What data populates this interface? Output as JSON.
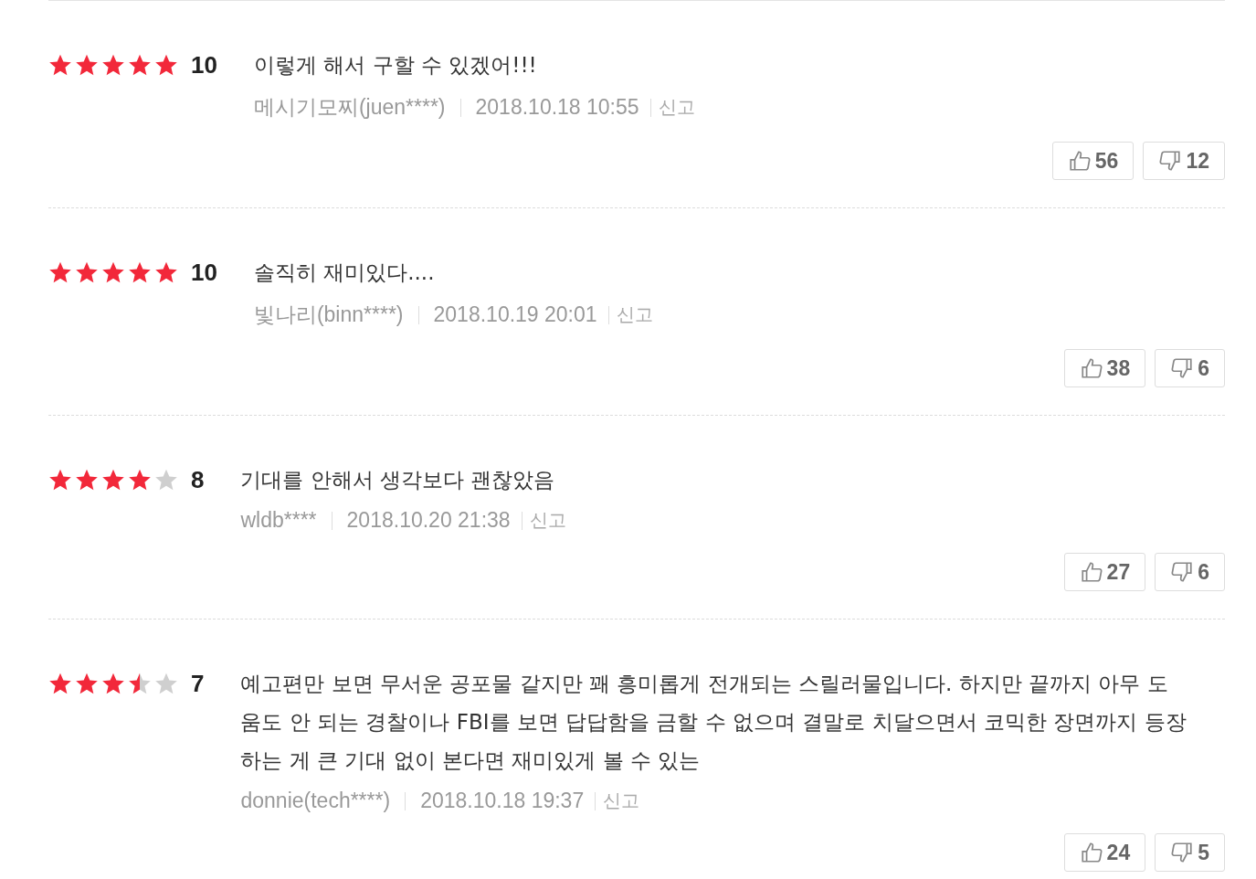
{
  "reviews": [
    {
      "stars": 5,
      "score": "10",
      "text": "이렇게 해서 구할 수 있겠어!!!",
      "author": "메시기모찌(juen****)",
      "date": "2018.10.18 10:55",
      "report": "신고",
      "likes": "56",
      "dislikes": "12"
    },
    {
      "stars": 5,
      "score": "10",
      "text": "솔직히 재미있다....",
      "author": "빛나리(binn****)",
      "date": "2018.10.19 20:01",
      "report": "신고",
      "likes": "38",
      "dislikes": "6"
    },
    {
      "stars": 4,
      "score": "8",
      "text": "기대를 안해서 생각보다 괜찮았음",
      "author": "wldb****",
      "date": "2018.10.20 21:38",
      "report": "신고",
      "likes": "27",
      "dislikes": "6"
    },
    {
      "stars": 3.5,
      "score": "7",
      "text": "예고편만 보면 무서운 공포물 같지만 꽤 흥미롭게 전개되는 스릴러물입니다. 하지만 끝까지 아무 도움도 안 되는 경찰이나 FBI를 보면 답답함을 금할 수 없으며 결말로 치달으면서 코믹한 장면까지 등장하는 게 큰 기대 없이 본다면 재미있게 볼 수 있는",
      "author": "donnie(tech****)",
      "date": "2018.10.18 19:37",
      "report": "신고",
      "likes": "24",
      "dislikes": "5"
    }
  ]
}
